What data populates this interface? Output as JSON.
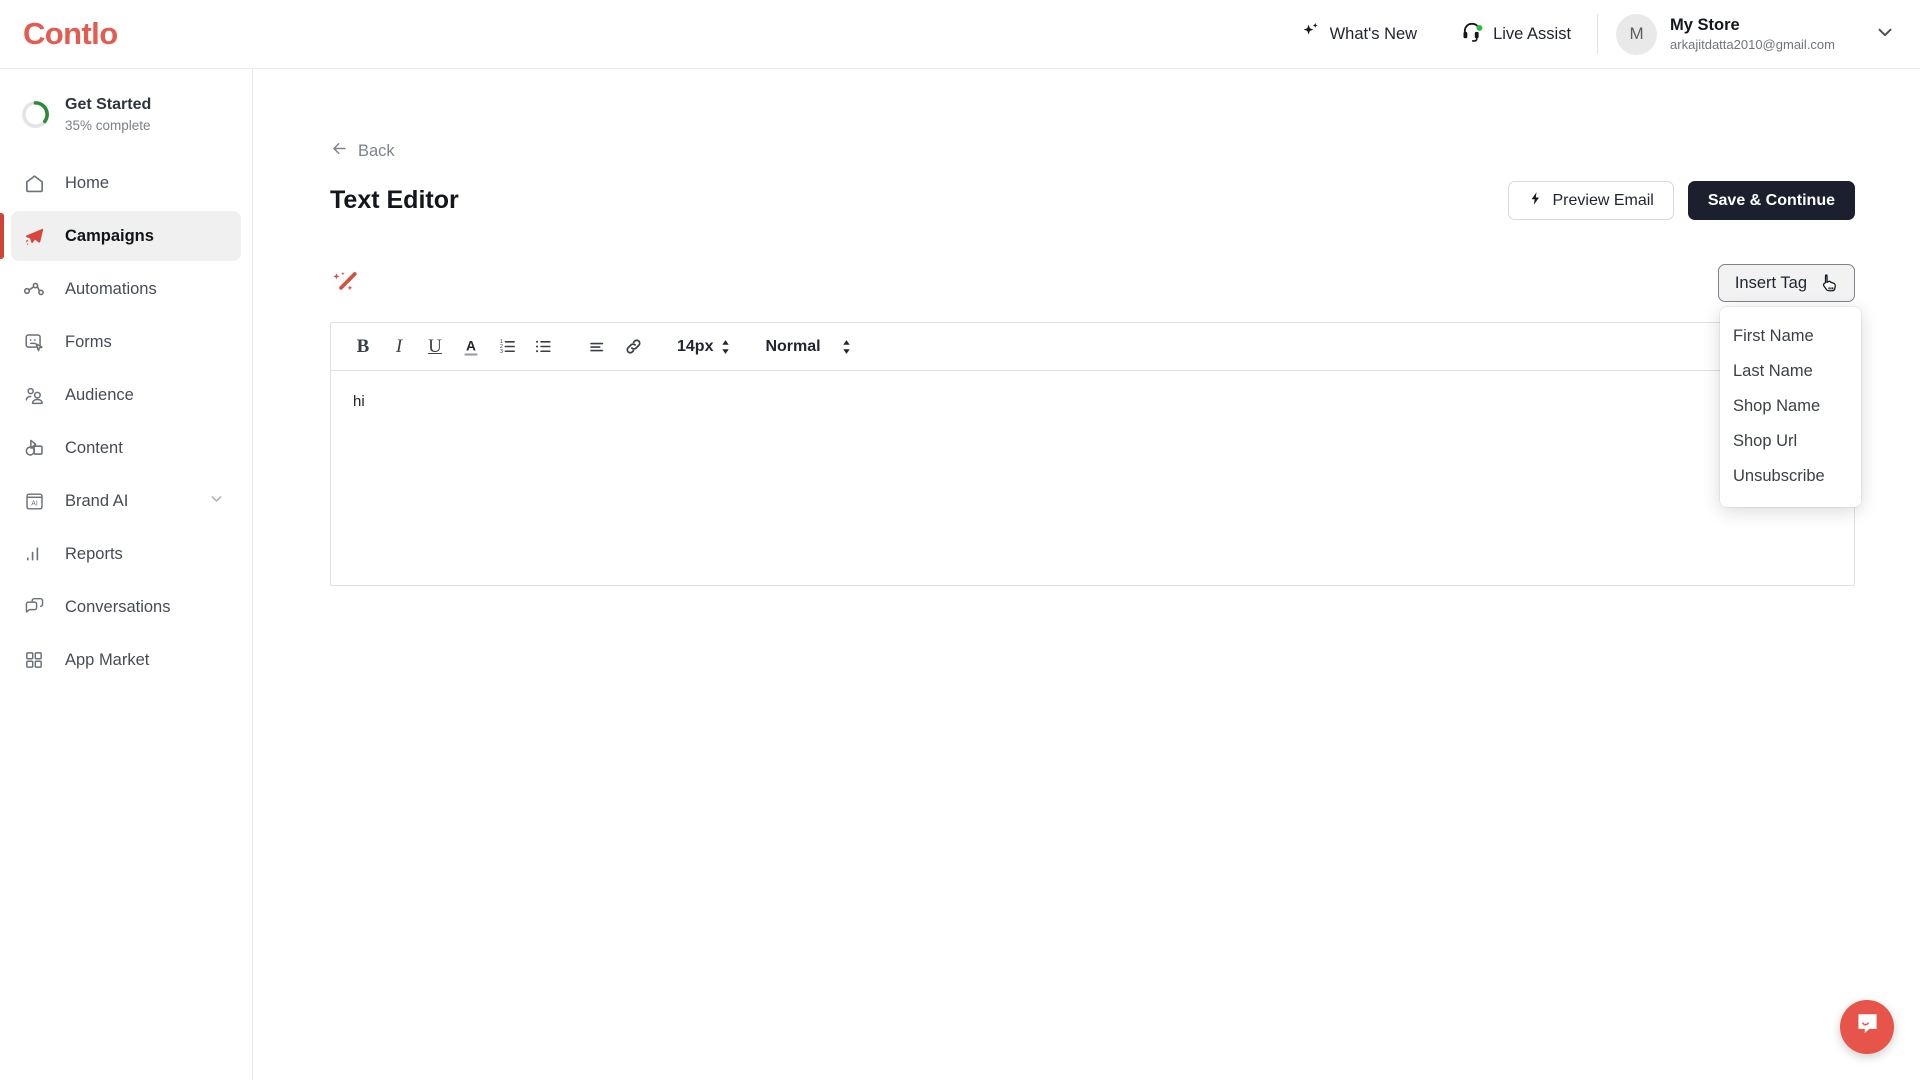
{
  "brand": {
    "name": "Contlo"
  },
  "topbar": {
    "whats_new": "What's New",
    "live_assist": "Live Assist",
    "profile": {
      "initial": "M",
      "store_name": "My Store",
      "email": "arkajitdatta2010@gmail.com"
    }
  },
  "sidebar": {
    "get_started": {
      "title": "Get Started",
      "subtitle": "35% complete",
      "percent": 35
    },
    "items": [
      {
        "label": "Home",
        "icon": "home-icon",
        "active": false
      },
      {
        "label": "Campaigns",
        "icon": "paper-plane-icon",
        "active": true
      },
      {
        "label": "Automations",
        "icon": "nodes-icon",
        "active": false
      },
      {
        "label": "Forms",
        "icon": "form-click-icon",
        "active": false
      },
      {
        "label": "Audience",
        "icon": "people-icon",
        "active": false
      },
      {
        "label": "Content",
        "icon": "content-shapes-icon",
        "active": false
      },
      {
        "label": "Brand AI",
        "icon": "ai-badge-icon",
        "active": false,
        "expandable": true
      },
      {
        "label": "Reports",
        "icon": "bar-chart-icon",
        "active": false
      },
      {
        "label": "Conversations",
        "icon": "chat-bubbles-icon",
        "active": false
      },
      {
        "label": "App Market",
        "icon": "grid-squares-icon",
        "active": false
      }
    ]
  },
  "main": {
    "back_label": "Back",
    "page_title": "Text Editor",
    "preview_button": "Preview Email",
    "save_button": "Save & Continue",
    "magic_wand_icon": "magic-wand-icon",
    "insert_tag": {
      "label": "Insert Tag",
      "open": true,
      "options": [
        "First Name",
        "Last Name",
        "Shop Name",
        "Shop Url",
        "Unsubscribe"
      ]
    },
    "editor": {
      "toolbar": {
        "bold": "B",
        "italic": "I",
        "underline": "U",
        "text_color": "A",
        "ordered_list_icon": "numbered-list-icon",
        "bullet_list_icon": "bullet-list-icon",
        "align_icon": "align-left-icon",
        "link_icon": "link-icon",
        "font_size": "14px",
        "font_style": "Normal"
      },
      "content": "hi"
    }
  },
  "chat_widget": {
    "icon": "intercom-chat-icon",
    "color": "#e7554a"
  },
  "colors": {
    "accent": "#e35c50",
    "active_bar": "#cf4436",
    "dark_button": "#1b1f2e",
    "progress": "#2e8b35"
  }
}
